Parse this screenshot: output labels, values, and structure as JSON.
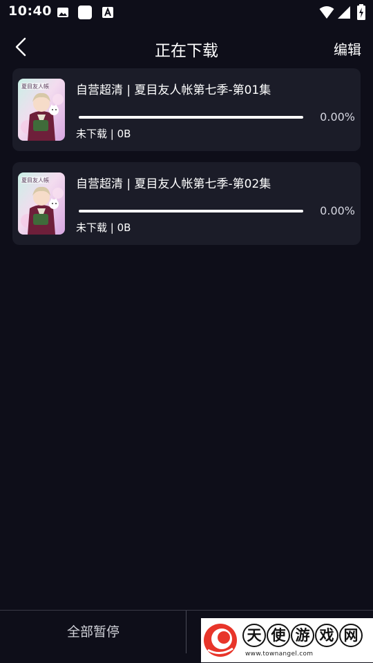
{
  "status_bar": {
    "time": "10:40",
    "icons": [
      "image-icon",
      "square-icon",
      "font-a-icon",
      "wifi-icon",
      "cell-signal-icon",
      "battery-charging-icon"
    ]
  },
  "header": {
    "back_icon": "chevron-left-icon",
    "title": "正在下载",
    "edit_label": "编辑"
  },
  "downloads": [
    {
      "title": "自营超清 | 夏目友人帐第七季-第01集",
      "progress": 0.0,
      "percent_text": "0.00%",
      "status": "未下载 | 0B",
      "thumb_logo": "夏目友人帳"
    },
    {
      "title": "自营超清 | 夏目友人帐第七季-第02集",
      "progress": 0.0,
      "percent_text": "0.00%",
      "status": "未下载 | 0B",
      "thumb_logo": "夏目友人帳"
    }
  ],
  "bottom_bar": {
    "pause_all_label": "全部暂停"
  },
  "watermark": {
    "chars": [
      "天",
      "使",
      "游",
      "戏",
      "网"
    ],
    "url": "www.townangel.com"
  },
  "colors": {
    "background": "#0e0e19",
    "card": "#1b1c28",
    "progress_track": "#ffffff",
    "watermark_red": "#e8352a"
  }
}
